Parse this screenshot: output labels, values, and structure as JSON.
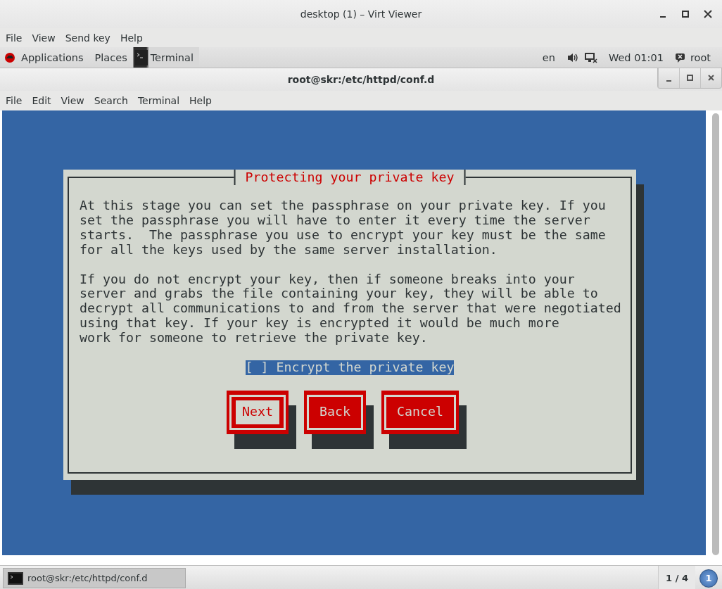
{
  "viewer": {
    "title": "desktop (1) – Virt Viewer",
    "menu": [
      "File",
      "View",
      "Send key",
      "Help"
    ]
  },
  "top_bar": {
    "menus": [
      "Applications",
      "Places"
    ],
    "task": "Terminal",
    "language": "en",
    "clock": "Wed 01:01",
    "user": "root"
  },
  "terminal": {
    "title": "root@skr:/etc/httpd/conf.d",
    "menu": [
      "File",
      "Edit",
      "View",
      "Search",
      "Terminal",
      "Help"
    ],
    "dialog": {
      "title": "Protecting your private key",
      "paragraphs": [
        [
          "At this stage you can set the passphrase on your private key. If you",
          "set the passphrase you will have to enter it every time the server",
          "starts.  The passphrase you use to encrypt your key must be the same",
          "for all the keys used by the same server installation."
        ],
        [
          "If you do not encrypt your key, then if someone breaks into your",
          "server and grabs the file containing your key, they will be able to",
          "decrypt all communications to and from the server that were negotiated",
          "using that key. If your key is encrypted it would be much more",
          "work for someone to retrieve the private key."
        ]
      ],
      "checkbox": {
        "brackets": "[ ]",
        "label": "Encrypt the private key",
        "checked": false,
        "selected": true
      },
      "buttons": [
        {
          "label": "Next",
          "selected": true
        },
        {
          "label": "Back",
          "selected": false
        },
        {
          "label": "Cancel",
          "selected": false
        }
      ]
    }
  },
  "taskbar": {
    "task": "root@skr:/etc/httpd/conf.d",
    "workspace": "1 / 4",
    "notifications": "1"
  }
}
